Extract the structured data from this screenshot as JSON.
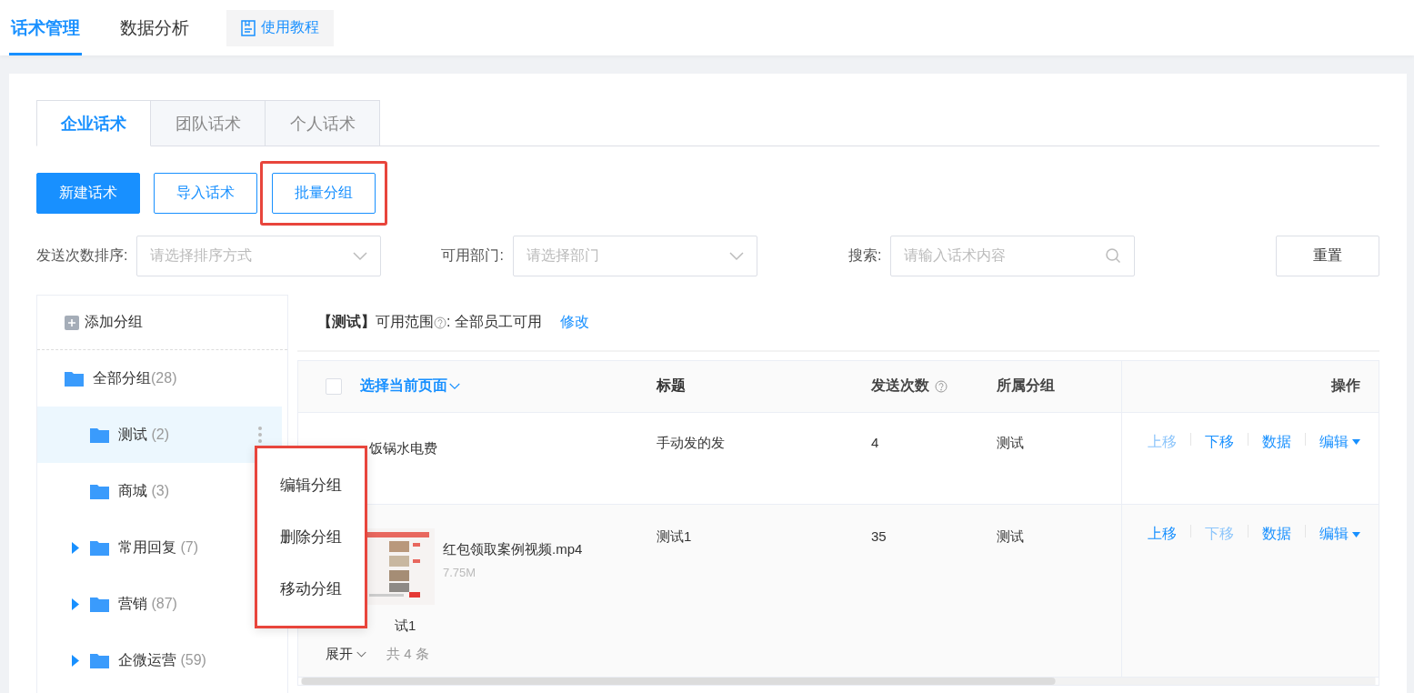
{
  "top_tabs": [
    {
      "label": "话术管理",
      "selected": true
    },
    {
      "label": "数据分析",
      "selected": false
    }
  ],
  "tutorial_button": {
    "label": "使用教程"
  },
  "sub_tabs": [
    {
      "label": "企业话术",
      "selected": true
    },
    {
      "label": "团队话术",
      "selected": false
    },
    {
      "label": "个人话术",
      "selected": false
    }
  ],
  "toolbar": [
    {
      "label": "新建话术",
      "kind": "primary",
      "highlighted": false
    },
    {
      "label": "导入话术",
      "kind": "outline",
      "highlighted": false
    },
    {
      "label": "批量分组",
      "kind": "outline",
      "highlighted": true
    }
  ],
  "filters": [
    {
      "kind": "select",
      "label": "发送次数排序:",
      "placeholder": "请选择排序方式"
    },
    {
      "kind": "select",
      "label": "可用部门:",
      "placeholder": "请选择部门"
    },
    {
      "kind": "search",
      "label": "搜索:",
      "placeholder": "请输入话术内容"
    }
  ],
  "reset_button": {
    "label": "重置"
  },
  "sidebar": {
    "add_label": "添加分组",
    "items": [
      {
        "label": "全部分组",
        "count": "(28)",
        "selected": false,
        "children": [
          {
            "label": "测试",
            "count": "(2)",
            "selected": true,
            "has_more": true
          },
          {
            "label": "商城",
            "count": "(3)",
            "selected": false
          },
          {
            "label": "常用回复",
            "count": "(7)",
            "selected": false,
            "expanded": false
          },
          {
            "label": "营销",
            "count": "(87)",
            "selected": false,
            "expanded": false
          },
          {
            "label": "企微运营",
            "count": "(59)",
            "selected": false,
            "expanded": false
          }
        ]
      }
    ]
  },
  "context_menu": {
    "highlighted": true,
    "items": [
      "编辑分组",
      "删除分组",
      "移动分组"
    ]
  },
  "scope": {
    "group": "【测试】",
    "label": "可用范围",
    "value": ": 全部员工可用",
    "action": "修改"
  },
  "table": {
    "select_all_checked": false,
    "select_label": "选择当前页面",
    "columns": [
      "标题",
      "发送次数",
      "所属分组",
      "操作"
    ],
    "rows": [
      {
        "kind": "text",
        "content": "饭锅水电费",
        "title": "手动发的发",
        "sends": "4",
        "group": "测试",
        "actions": [
          {
            "label": "上移",
            "disabled": true
          },
          {
            "label": "下移",
            "disabled": false
          },
          {
            "label": "数据",
            "disabled": false
          },
          {
            "label": "编辑",
            "disabled": false
          }
        ]
      },
      {
        "kind": "file",
        "file_name": "红包领取案例视频.mp4",
        "file_size": "7.75M",
        "content": "试1",
        "expand_label": "展开",
        "total": "共 4 条",
        "title": "测试1",
        "sends": "35",
        "group": "测试",
        "actions": [
          {
            "label": "上移",
            "disabled": false
          },
          {
            "label": "下移",
            "disabled": true
          },
          {
            "label": "数据",
            "disabled": false
          },
          {
            "label": "编辑",
            "disabled": false
          }
        ]
      }
    ]
  }
}
